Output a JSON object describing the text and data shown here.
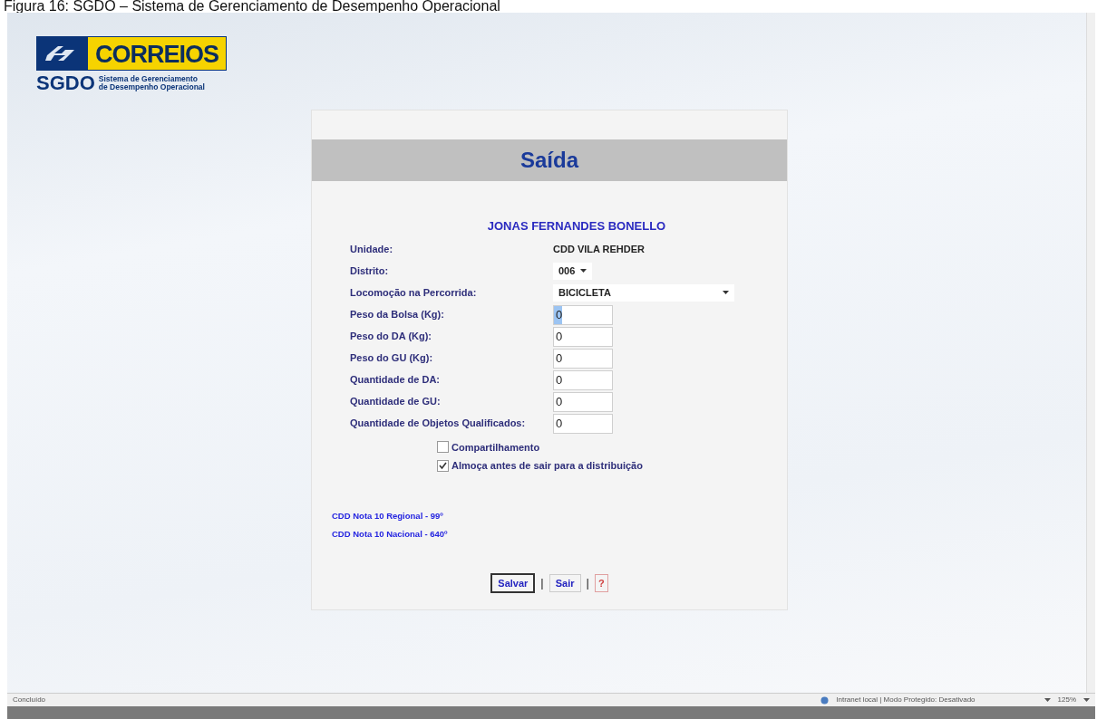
{
  "caption": "Figura 16: SGDO – Sistema de Gerenciamento de Desempenho Operacional",
  "logo": {
    "brand": "CORREIOS",
    "acronym": "SGDO",
    "subtitle_lines": [
      "Sistema de Gerenciamento",
      "de Desempenho Operacional"
    ]
  },
  "panel": {
    "title": "Saída",
    "employee": "JONAS FERNANDES BONELLO",
    "fields": [
      {
        "kind": "text",
        "label": "Unidade:",
        "value": "CDD VILA REHDER"
      },
      {
        "kind": "select",
        "label": "Distrito:",
        "value": "006"
      },
      {
        "kind": "wide-select",
        "label": "Locomoção na Percorrida:",
        "value": "BICICLETA"
      },
      {
        "kind": "input",
        "label": "Peso da Bolsa (Kg):",
        "value": "0",
        "highlighted": true
      },
      {
        "kind": "input",
        "label": "Peso do DA (Kg):",
        "value": "0",
        "highlighted": false
      },
      {
        "kind": "input",
        "label": "Peso do GU (Kg):",
        "value": "0",
        "highlighted": false
      },
      {
        "kind": "input",
        "label": "Quantidade de DA:",
        "value": "0",
        "highlighted": false
      },
      {
        "kind": "input",
        "label": "Quantidade de GU:",
        "value": "0",
        "highlighted": false
      },
      {
        "kind": "input",
        "label": "Quantidade de Objetos Qualificados:",
        "value": "0",
        "highlighted": false
      }
    ],
    "checkboxes": [
      {
        "label": "Compartilhamento",
        "checked": false
      },
      {
        "label": "Almoça antes de sair para a distribuição",
        "checked": true
      }
    ],
    "rankings": [
      "CDD Nota 10 Regional - 99º",
      "CDD Nota 10 Nacional - 640º"
    ],
    "actions": [
      {
        "kind": "primary",
        "label": "Salvar"
      },
      {
        "kind": "separator",
        "label": "|"
      },
      {
        "kind": "button",
        "label": "Sair"
      },
      {
        "kind": "separator",
        "label": "|"
      },
      {
        "kind": "help",
        "label": "?"
      }
    ]
  },
  "status_bar": {
    "state": "Concluído",
    "zone": "Intranet local | Modo Protegido: Desativado",
    "zoom": "125%"
  }
}
